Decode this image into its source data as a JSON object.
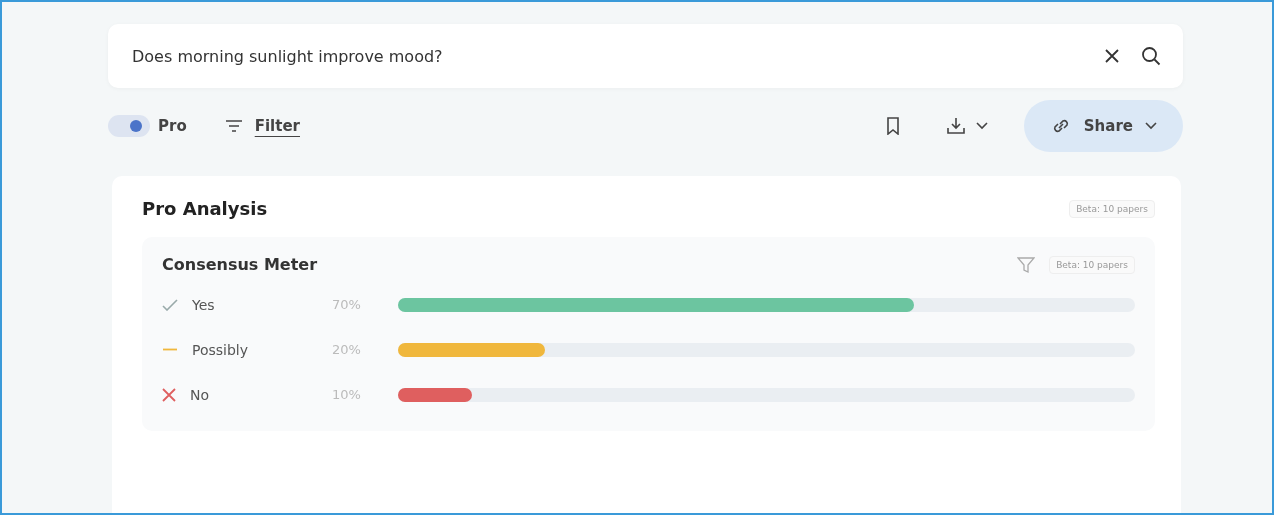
{
  "search": {
    "value": "Does morning sunlight improve mood?"
  },
  "toolbar": {
    "pro_toggle": {
      "label": "Pro",
      "on": true
    },
    "filter": {
      "label": "Filter"
    },
    "share": {
      "label": "Share"
    }
  },
  "card": {
    "title": "Pro Analysis",
    "badge": "Beta: 10 papers",
    "meter": {
      "title": "Consensus Meter",
      "badge": "Beta: 10 papers",
      "rows": [
        {
          "kind": "check",
          "label": "Yes",
          "reading": "70%",
          "level": 0.7,
          "color": "#6cc5a0"
        },
        {
          "kind": "dash",
          "label": "Possibly",
          "reading": "20%",
          "level": 0.2,
          "color": "#f0b73c"
        },
        {
          "kind": "cross",
          "label": "No",
          "reading": "10%",
          "level": 0.1,
          "color": "#df5f5f"
        }
      ]
    }
  }
}
